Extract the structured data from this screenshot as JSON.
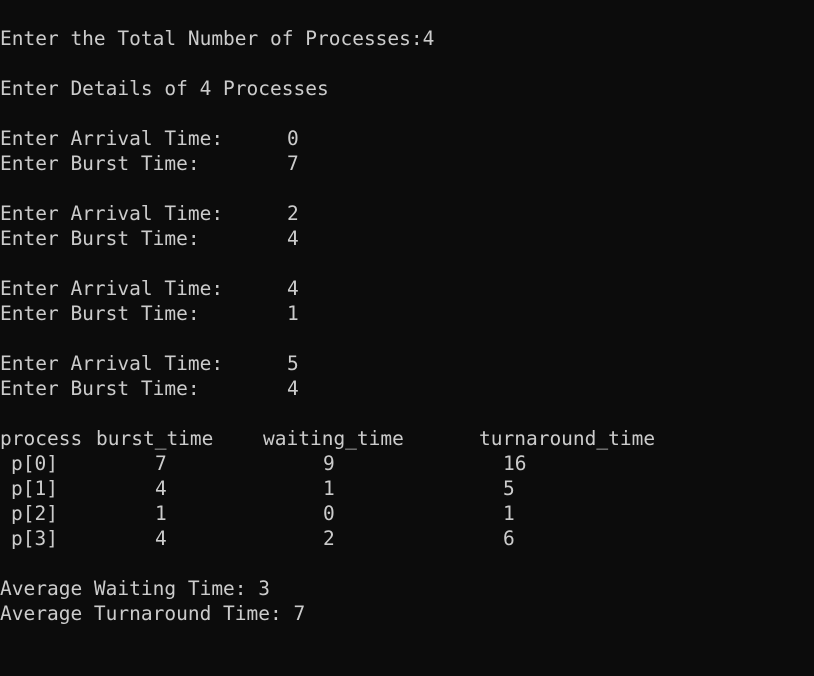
{
  "console": {
    "prompt_total": "Enter the Total Number of Processes:4",
    "details_header": "Enter Details of 4 Processes",
    "inputs": [
      {
        "arrival_label": "Enter Arrival Time:",
        "arrival_value": "0",
        "burst_label": "Enter Burst Time:",
        "burst_value": "7"
      },
      {
        "arrival_label": "Enter Arrival Time:",
        "arrival_value": "2",
        "burst_label": "Enter Burst Time:",
        "burst_value": "4"
      },
      {
        "arrival_label": "Enter Arrival Time:",
        "arrival_value": "4",
        "burst_label": "Enter Burst Time:",
        "burst_value": "1"
      },
      {
        "arrival_label": "Enter Arrival Time:",
        "arrival_value": "5",
        "burst_label": "Enter Burst Time:",
        "burst_value": "4"
      }
    ],
    "table": {
      "headers": {
        "process": "process",
        "burst_time": "burst_time",
        "waiting_time": "waiting_time",
        "turnaround_time": "turnaround_time"
      },
      "rows": [
        {
          "process": "p[0]",
          "burst_time": "7",
          "waiting_time": "9",
          "turnaround_time": "16"
        },
        {
          "process": "p[1]",
          "burst_time": "4",
          "waiting_time": "1",
          "turnaround_time": "5"
        },
        {
          "process": "p[2]",
          "burst_time": "1",
          "waiting_time": "0",
          "turnaround_time": "1"
        },
        {
          "process": "p[3]",
          "burst_time": "4",
          "waiting_time": "2",
          "turnaround_time": "6"
        }
      ]
    },
    "avg_waiting": "Average Waiting Time: 3",
    "avg_turnaround": "Average Turnaround Time: 7"
  },
  "colors": {
    "background": "#0c0c0c",
    "text": "#cccccc"
  }
}
